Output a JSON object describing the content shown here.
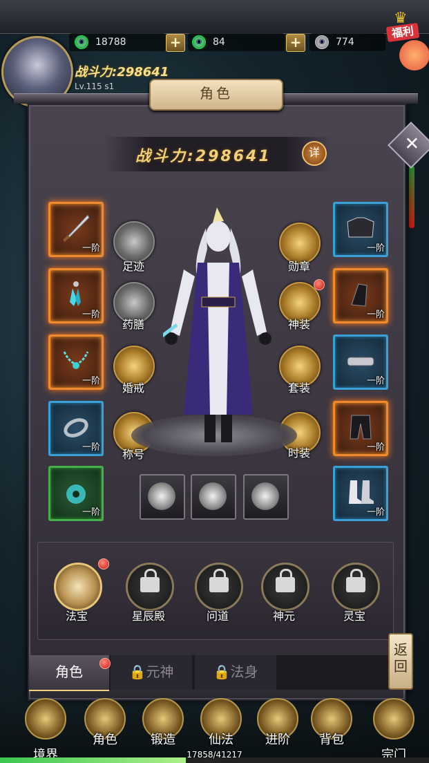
{
  "resources": [
    {
      "icon": "jade-coin-icon",
      "value": "18788"
    },
    {
      "icon": "bound-jade-icon",
      "value": "84"
    },
    {
      "icon": "silver-coin-icon",
      "value": "774"
    }
  ],
  "welfare_label": "福利",
  "player": {
    "power_label": "战斗力:298641",
    "level_text": "Lv.115 s1"
  },
  "panel": {
    "title": "角色",
    "power_label": "战斗力:",
    "power_value": "298641",
    "detail_label": "详"
  },
  "left_slots": [
    {
      "tier": "一阶",
      "quality": "orange",
      "icon": "sword-icon"
    },
    {
      "tier": "一阶",
      "quality": "orange",
      "icon": "earring-icon"
    },
    {
      "tier": "一阶",
      "quality": "orange",
      "icon": "necklace-icon"
    },
    {
      "tier": "一阶",
      "quality": "blue",
      "icon": "ring-icon"
    },
    {
      "tier": "一阶",
      "quality": "green",
      "icon": "jade-pendant-icon"
    }
  ],
  "right_slots": [
    {
      "tier": "一阶",
      "quality": "blue",
      "icon": "shoulder-armor-icon"
    },
    {
      "tier": "一阶",
      "quality": "orange",
      "icon": "bracer-icon"
    },
    {
      "tier": "一阶",
      "quality": "blue",
      "icon": "belt-icon"
    },
    {
      "tier": "一阶",
      "quality": "orange",
      "icon": "pants-icon"
    },
    {
      "tier": "一阶",
      "quality": "blue",
      "icon": "boots-icon"
    }
  ],
  "left_funcs": [
    "足迹",
    "药膳",
    "婚戒",
    "称号"
  ],
  "right_funcs": [
    "勋章",
    "神装",
    "套装",
    "时装"
  ],
  "small_boxes": [
    "gauntlet-icon",
    "orb-icon",
    "cauldron-icon"
  ],
  "treasures": [
    "法宝",
    "星辰殿",
    "问道",
    "神元",
    "灵宝"
  ],
  "tabs": [
    "角色",
    "元神",
    "法身"
  ],
  "return_label": "返回",
  "nav": [
    "境界",
    "角色",
    "锻造",
    "仙法",
    "进阶",
    "背包",
    "宗门"
  ],
  "xp": {
    "text": "17858/41217",
    "fraction": 0.433
  },
  "colors": {
    "orange": "#f08a2a",
    "blue": "#3aa0d8",
    "green": "#46b04a",
    "gold": "#f4cf7a"
  }
}
